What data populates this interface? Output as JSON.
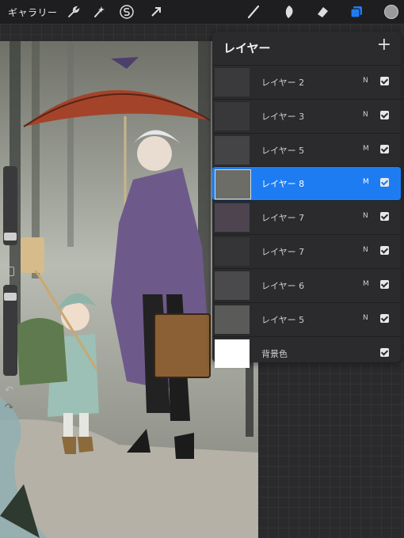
{
  "toolbar": {
    "gallery_label": "ギャラリー",
    "left_icons": [
      "wrench-icon",
      "magic-wand-icon",
      "selection-s-icon",
      "transform-arrow-icon"
    ],
    "right_icons": [
      "brush-icon",
      "smudge-icon",
      "eraser-icon",
      "layers-icon",
      "color-swatch-icon"
    ],
    "active_color": "#9a9a9a",
    "layers_icon_color": "#1e7cf2"
  },
  "layers": {
    "title": "レイヤー",
    "add_label": "+",
    "items": [
      {
        "name": "レイヤー 2",
        "mode": "N",
        "visible": true,
        "active": false
      },
      {
        "name": "レイヤー 3",
        "mode": "N",
        "visible": true,
        "active": false
      },
      {
        "name": "レイヤー 5",
        "mode": "M",
        "visible": true,
        "active": false
      },
      {
        "name": "レイヤー 8",
        "mode": "M",
        "visible": true,
        "active": true
      },
      {
        "name": "レイヤー 7",
        "mode": "N",
        "visible": true,
        "active": false
      },
      {
        "name": "レイヤー 7",
        "mode": "N",
        "visible": true,
        "active": false
      },
      {
        "name": "レイヤー 6",
        "mode": "M",
        "visible": true,
        "active": false
      },
      {
        "name": "レイヤー 5",
        "mode": "N",
        "visible": true,
        "active": false
      },
      {
        "name": "背景色",
        "mode": "",
        "visible": true,
        "active": false
      }
    ]
  },
  "sidebar": {
    "brush_size_icon": "slider-handle",
    "modify_icon": "square-icon",
    "opacity_icon": "slider-handle",
    "undo_icon": "undo-icon",
    "redo_icon": "redo-icon"
  }
}
